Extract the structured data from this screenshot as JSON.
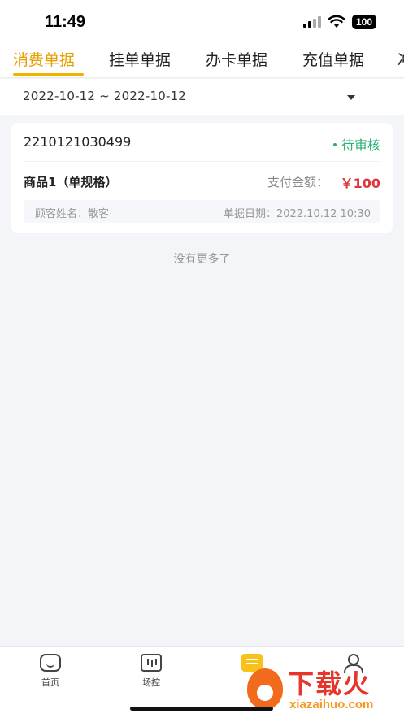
{
  "status_bar": {
    "time": "11:49",
    "battery": "100"
  },
  "tabs": [
    {
      "label": "消费单据",
      "active": true
    },
    {
      "label": "挂单单据",
      "active": false
    },
    {
      "label": "办卡单据",
      "active": false
    },
    {
      "label": "充值单据",
      "active": false
    },
    {
      "label": "冲",
      "active": false
    }
  ],
  "date_filter": {
    "range": "2022-10-12 ~ 2022-10-12"
  },
  "orders": [
    {
      "order_no": "2210121030499",
      "status": "待审核",
      "product": "商品1（单规格）",
      "pay_label": "支付金额：",
      "pay_amount": "￥100",
      "customer": "顾客姓名：散客",
      "date": "单据日期：2022.10.12 10:30"
    }
  ],
  "list_end_text": "没有更多了",
  "bottom_nav": [
    {
      "label": "首页",
      "icon": "home-icon"
    },
    {
      "label": "场控",
      "icon": "monitor-icon"
    },
    {
      "label": "",
      "icon": "document-icon"
    },
    {
      "label": "",
      "icon": "user-icon"
    }
  ],
  "watermark": {
    "title": "下载火",
    "url": "xiazaihuo.com"
  },
  "colors": {
    "accent": "#f0b400",
    "status_green": "#2baf73",
    "price_red": "#e0373f"
  }
}
